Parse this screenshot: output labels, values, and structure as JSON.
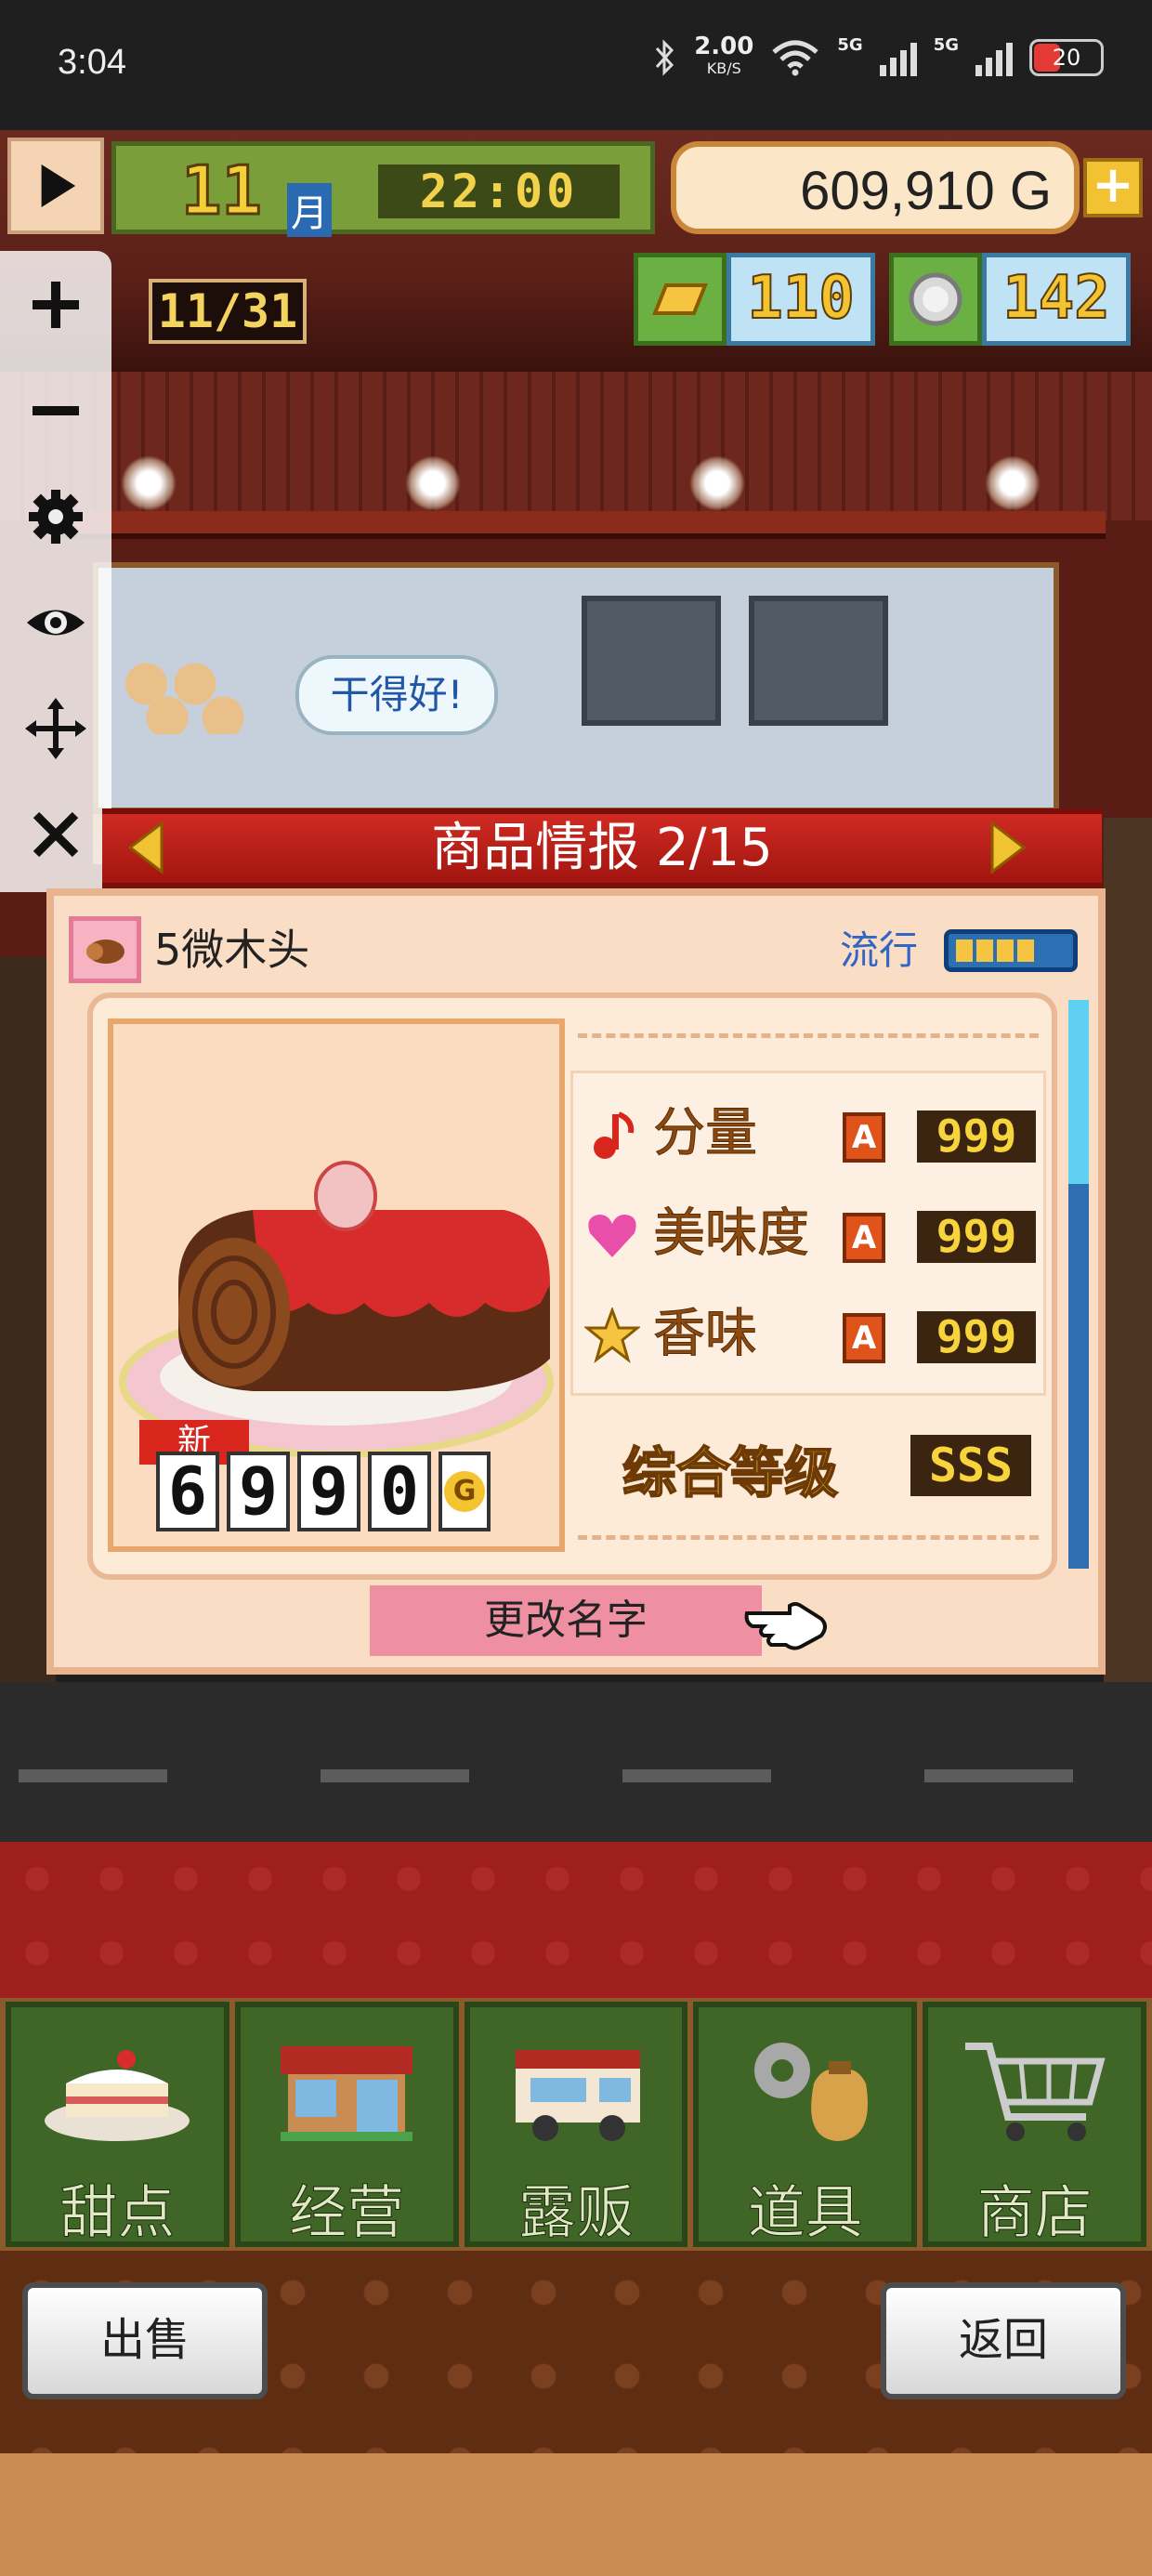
{
  "status_bar": {
    "time": "3:04",
    "net_speed": "2.00",
    "net_unit": "KB/S",
    "signal_1_label": "5G",
    "signal_2_label": "5G",
    "battery": "20"
  },
  "hud": {
    "month": "11",
    "month_label": "月",
    "clock": "22:00",
    "money": "609,910 G",
    "money_add": "+",
    "mini_date": "11/31",
    "gold_tickets": "110",
    "silver_coins": "142"
  },
  "scene": {
    "speech_bubble": "干得好!"
  },
  "toolbar": {
    "icons": [
      "play-icon",
      "plus-icon",
      "minus-icon",
      "gear-icon",
      "eye-icon",
      "move-icon",
      "close-icon"
    ]
  },
  "panel": {
    "title": "商品情报 2/15",
    "item_name": "5微木头",
    "trend_label": "流行",
    "trend_level": 4,
    "trend_max": 4,
    "new_tag": "新",
    "price_digits": [
      "6",
      "9",
      "9",
      "0"
    ],
    "price_unit": "G",
    "stats": [
      {
        "label": "分量",
        "grade": "A",
        "value": "999",
        "icon": "music-note-icon"
      },
      {
        "label": "美味度",
        "grade": "A",
        "value": "999",
        "icon": "heart-icon"
      },
      {
        "label": "香味",
        "grade": "A",
        "value": "999",
        "icon": "star-icon"
      }
    ],
    "overall_label": "综合等级",
    "overall_value": "SSS",
    "rename_button": "更改名字"
  },
  "nav": [
    {
      "label": "甜点",
      "icon": "cake-icon"
    },
    {
      "label": "经营",
      "icon": "shop-building-icon"
    },
    {
      "label": "露贩",
      "icon": "food-truck-icon"
    },
    {
      "label": "道具",
      "icon": "items-bag-icon"
    },
    {
      "label": "商店",
      "icon": "shopping-cart-icon"
    }
  ],
  "footer": {
    "sell_button": "出售",
    "back_button": "返回"
  },
  "colors": {
    "title_red": "#c0221a",
    "nav_green": "#3f6527",
    "panel_bg": "#f9ddc4",
    "trend_blue": "#2c6fb2"
  }
}
